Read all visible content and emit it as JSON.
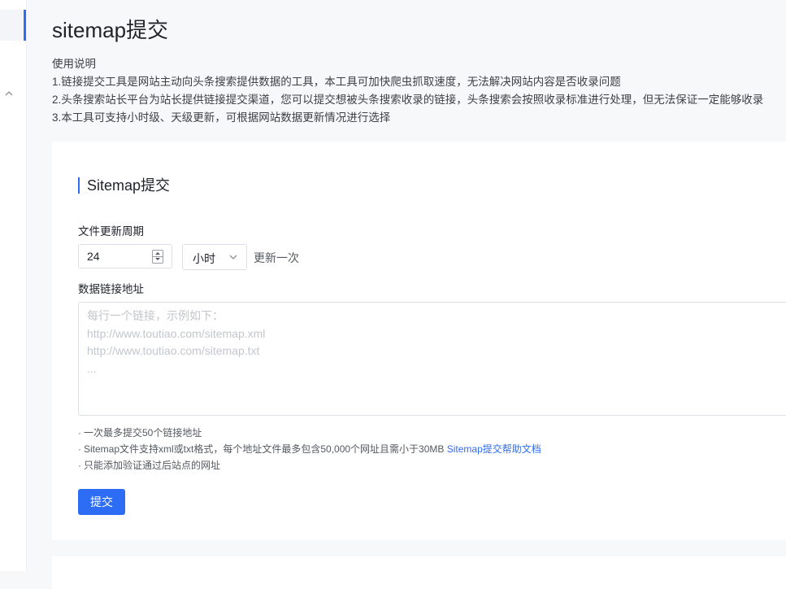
{
  "page": {
    "title": "sitemap提交"
  },
  "usage": {
    "heading": "使用说明",
    "items": [
      "1.链接提交工具是网站主动向头条搜索提供数据的工具，本工具可加快爬虫抓取速度，无法解决网站内容是否收录问题",
      "2.头条搜索站长平台为站长提供链接提交渠道，您可以提交想被头条搜索收录的链接，头条搜索会按照收录标准进行处理，但无法保证一定能够收录",
      "3.本工具可支持小时级、天级更新，可根据网站数据更新情况进行选择"
    ]
  },
  "form": {
    "section_title": "Sitemap提交",
    "period_label": "文件更新周期",
    "period_value": "24",
    "period_unit": "小时",
    "period_suffix": "更新一次",
    "url_label": "数据链接地址",
    "url_placeholder": "每行一个链接，示例如下：\nhttp://www.toutiao.com/sitemap.xml\nhttp://www.toutiao.com/sitemap.txt\n...",
    "notes": [
      "一次最多提交50个链接地址",
      "Sitemap文件支持xml或txt格式，每个地址文件最多包含50,000个网址且需小于30MB",
      "只能添加验证通过后站点的网址"
    ],
    "note_bullet": "·",
    "help_link": "Sitemap提交帮助文档",
    "submit_label": "提交"
  },
  "colors": {
    "accent": "#2d6df6",
    "background": "#f7f8fa",
    "card": "#ffffff"
  },
  "icons": {
    "sidebar_toggle": "chevron-up-icon",
    "select_arrow": "chevron-down-icon",
    "stepper": "number-stepper-icon"
  }
}
